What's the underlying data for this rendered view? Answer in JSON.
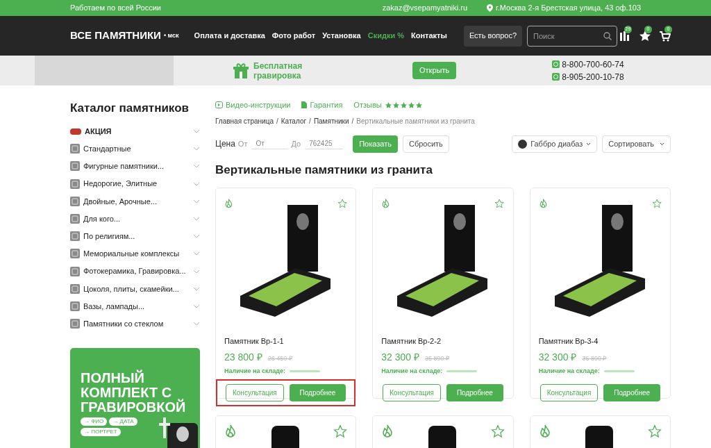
{
  "top_bar": {
    "region": "Работаем по всей России",
    "email": "zakaz@vsepamyatniki.ru",
    "address": "г.Москва 2-я Брестская улица, 43 оф.103"
  },
  "header": {
    "logo": "ВСЕ ПАМЯТНИКИ",
    "logo_city": "• мск",
    "nav": [
      {
        "label": "Оплата и доставка",
        "highlight": false
      },
      {
        "label": "Фото работ",
        "highlight": false
      },
      {
        "label": "Установка",
        "highlight": false
      },
      {
        "label": "Скидки %",
        "highlight": true
      },
      {
        "label": "Контакты",
        "highlight": false
      }
    ],
    "question_button": "Есть вопрос?",
    "search": {
      "placeholder": "Поиск"
    },
    "counters": [
      {
        "kind": "compare",
        "count": "29"
      },
      {
        "kind": "favorites",
        "count": "0"
      },
      {
        "kind": "cart",
        "count": "0"
      }
    ]
  },
  "promo": {
    "title": "Бесплатная гравировка",
    "button": "Открыть",
    "phones": [
      "8-800-700-60-74",
      "8-905-200-10-78"
    ]
  },
  "sidebar": {
    "title": "Каталог памятников",
    "items": [
      {
        "label": "АКЦИЯ",
        "kind": "sale"
      },
      {
        "label": "Стандартные",
        "kind": "normal"
      },
      {
        "label": "Фигурные памятники...",
        "kind": "normal"
      },
      {
        "label": "Недорогие, Элитные",
        "kind": "normal"
      },
      {
        "label": "Двойные, Арочные...",
        "kind": "normal"
      },
      {
        "label": "Для кого...",
        "kind": "normal"
      },
      {
        "label": "По религиям...",
        "kind": "normal"
      },
      {
        "label": "Мемориальные комплексы",
        "kind": "normal"
      },
      {
        "label": "Фотокерамика, Гравировка...",
        "kind": "normal"
      },
      {
        "label": "Цоколя, плиты, скамейки...",
        "kind": "normal"
      },
      {
        "label": "Вазы, лампады...",
        "kind": "normal"
      },
      {
        "label": "Памятники со стеклом",
        "kind": "normal"
      }
    ],
    "banner": {
      "headline": "ПОЛНЫЙ КОМПЛЕКТ С ГРАВИРОВКОЙ",
      "chips": [
        "→ ФИО",
        "→ ДАТА",
        "→ ПОРТРЕТ"
      ]
    }
  },
  "info_links": [
    {
      "label": "Видео-инструкции",
      "kind": "video"
    },
    {
      "label": "Гарантия",
      "kind": "doc"
    },
    {
      "label": "Отзывы",
      "kind": "reviews",
      "stars": 5
    }
  ],
  "breadcrumb_separator": "/",
  "breadcrumbs": [
    "Главная страница",
    "Каталог",
    "Памятники",
    "Вертикальные памятники из гранита"
  ],
  "filter": {
    "label": "Цена",
    "from_label": "От",
    "from_placeholder": "От",
    "to_label": "До",
    "to_placeholder": "762425",
    "apply": "Показать",
    "reset": "Сбросить",
    "material": "Габбро диабаз",
    "sort": "Сортировать"
  },
  "heading": "Вертикальные памятники из гранита",
  "products": [
    {
      "name": "Памятник Вр-1-1",
      "price": "23 800 ₽",
      "old_price": "26 450 ₽",
      "stock_label": "Наличие на складе:",
      "consult": "Консультация",
      "more": "Подробнее",
      "favorite": false,
      "highlighted": true
    },
    {
      "name": "Памятник Вр-2-2",
      "price": "32 300 ₽",
      "old_price": "35 890 ₽",
      "stock_label": "Наличие на складе:",
      "consult": "Консультация",
      "more": "Подробнее",
      "favorite": false,
      "highlighted": false
    },
    {
      "name": "Памятник Вр-3-4",
      "price": "32 300 ₽",
      "old_price": "35 890 ₽",
      "stock_label": "Наличие на складе:",
      "consult": "Консультация",
      "more": "Подробнее",
      "favorite": false,
      "highlighted": false
    }
  ],
  "next_row": [
    {
      "favorite": false
    },
    {
      "favorite": false
    },
    {
      "favorite": false
    }
  ]
}
